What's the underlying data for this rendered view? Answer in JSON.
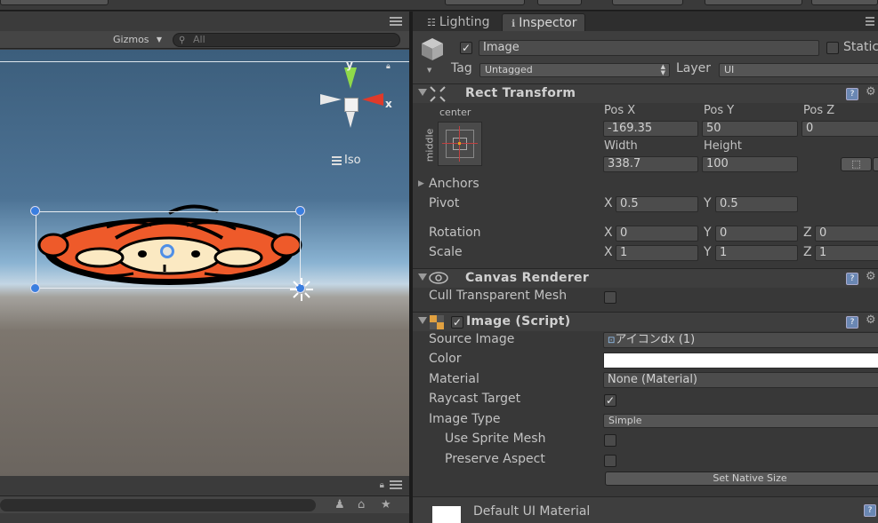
{
  "scene": {
    "gizmos_label": "Gizmos",
    "search_placeholder": "All",
    "axis_y": "y",
    "axis_x": "x",
    "projection_label": "Iso"
  },
  "tabs": {
    "lighting": "Lighting",
    "inspector": "Inspector"
  },
  "gameobject": {
    "active": true,
    "name": "Image",
    "static_label": "Static",
    "tag_label": "Tag",
    "tag_value": "Untagged",
    "layer_label": "Layer",
    "layer_value": "UI"
  },
  "rect_transform": {
    "title": "Rect Transform",
    "anchor_h": "center",
    "anchor_v": "middle",
    "pos_x_label": "Pos X",
    "pos_y_label": "Pos Y",
    "pos_z_label": "Pos Z",
    "pos_x": "-169.35",
    "pos_y": "50",
    "pos_z": "0",
    "width_label": "Width",
    "height_label": "Height",
    "width": "338.7",
    "height": "100",
    "anchors_label": "Anchors",
    "pivot_label": "Pivot",
    "pivot_x": "0.5",
    "pivot_y": "0.5",
    "rotation_label": "Rotation",
    "rot_x": "0",
    "rot_y": "0",
    "rot_z": "0",
    "scale_label": "Scale",
    "scale_x": "1",
    "scale_y": "1",
    "scale_z": "1",
    "x": "X",
    "y": "Y",
    "z": "Z"
  },
  "canvas_renderer": {
    "title": "Canvas Renderer",
    "cull_label": "Cull Transparent Mesh",
    "cull_value": false
  },
  "image_script": {
    "title": "Image (Script)",
    "enabled": true,
    "source_image_label": "Source Image",
    "source_image_value": "アイコンdx (1)",
    "color_label": "Color",
    "color_value": "#ffffff",
    "material_label": "Material",
    "material_value": "None (Material)",
    "raycast_label": "Raycast Target",
    "raycast_value": true,
    "image_type_label": "Image Type",
    "image_type_value": "Simple",
    "use_sprite_mesh_label": "Use Sprite Mesh",
    "preserve_aspect_label": "Preserve Aspect",
    "set_native_size": "Set Native Size"
  },
  "material_preview": {
    "name": "Default UI Material"
  },
  "colors": {
    "accent_blue": "#3a7ee0",
    "sprite_orange": "#ee5a2a",
    "gizmo_green": "#8fd94a",
    "gizmo_red": "#e03a2a"
  }
}
